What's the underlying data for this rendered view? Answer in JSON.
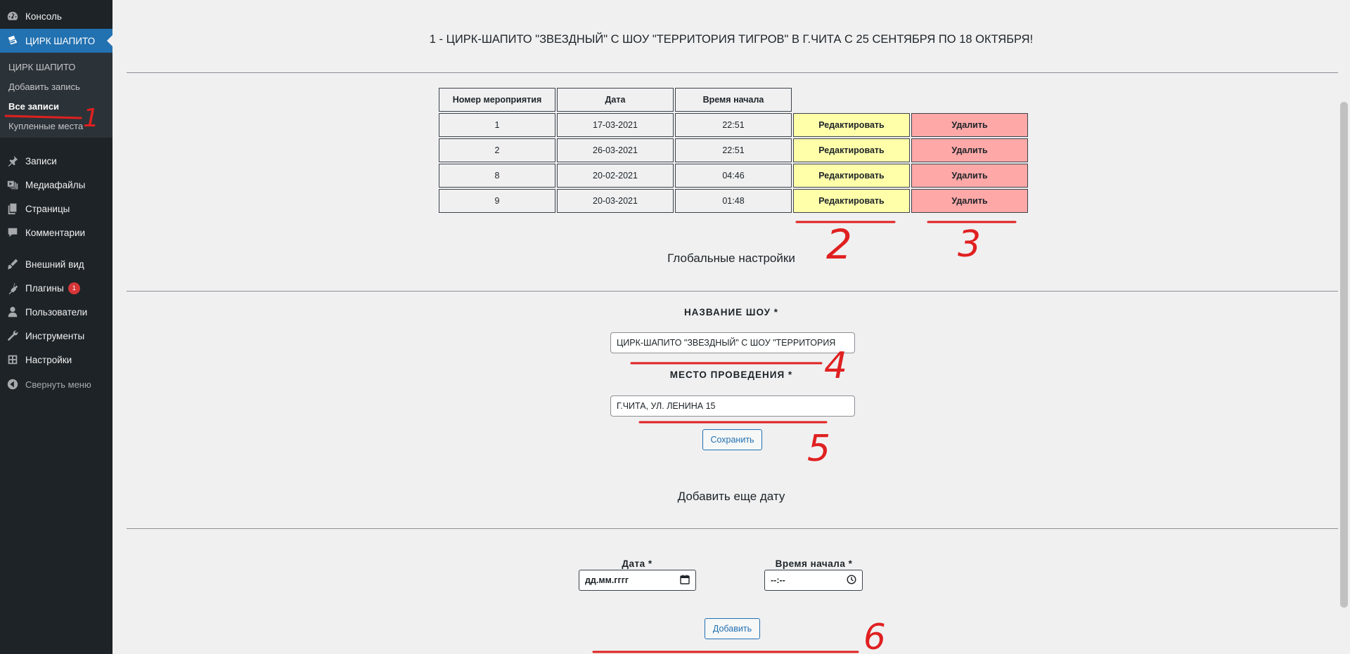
{
  "sidebar": {
    "items": [
      {
        "label": "Консоль",
        "icon": "dashboard-icon"
      },
      {
        "label": "ЦИРК ШАПИТО",
        "icon": "tickets-icon",
        "current": true
      },
      {
        "label": "Записи",
        "icon": "pin-icon"
      },
      {
        "label": "Медиафайлы",
        "icon": "media-icon"
      },
      {
        "label": "Страницы",
        "icon": "pages-icon"
      },
      {
        "label": "Комментарии",
        "icon": "comment-icon"
      },
      {
        "label": "Внешний вид",
        "icon": "brush-icon"
      },
      {
        "label": "Плагины",
        "icon": "plugin-icon",
        "badge": "1"
      },
      {
        "label": "Пользователи",
        "icon": "user-icon"
      },
      {
        "label": "Инструменты",
        "icon": "wrench-icon"
      },
      {
        "label": "Настройки",
        "icon": "settings-icon"
      }
    ],
    "submenu": [
      {
        "label": "ЦИРК ШАПИТО"
      },
      {
        "label": "Добавить запись"
      },
      {
        "label": "Все записи",
        "active": true
      },
      {
        "label": "Купленные места"
      }
    ],
    "collapse_label": "Свернуть меню"
  },
  "main": {
    "title": "1 - ЦИРК-ШАПИТО \"ЗВЕЗДНЫЙ\" С ШОУ \"ТЕРРИТОРИЯ ТИГРОВ\" В Г.ЧИТА С 25 СЕНТЯБРЯ ПО 18 ОКТЯБРЯ!",
    "table": {
      "headers": [
        "Номер мероприятия",
        "Дата",
        "Время начала"
      ],
      "rows": [
        {
          "id": "1",
          "date": "17-03-2021",
          "time": "22:51"
        },
        {
          "id": "2",
          "date": "26-03-2021",
          "time": "22:51"
        },
        {
          "id": "8",
          "date": "20-02-2021",
          "time": "04:46"
        },
        {
          "id": "9",
          "date": "20-03-2021",
          "time": "01:48"
        }
      ],
      "edit_label": "Редактировать",
      "delete_label": "Удалить"
    },
    "global_settings": {
      "heading": "Глобальные настройки",
      "show_name_label": "НАЗВАНИЕ ШОУ *",
      "show_name_value": "ЦИРК-ШАПИТО \"ЗВЕЗДНЫЙ\" С ШОУ \"ТЕРРИТОРИЯ",
      "venue_label": "МЕСТО ПРОВЕДЕНИЯ *",
      "venue_value": "Г.ЧИТА, УЛ. ЛЕНИНА 15",
      "save_label": "Сохранить"
    },
    "add_date": {
      "heading": "Добавить еще дату",
      "date_label": "Дата *",
      "date_placeholder": "дд.мм.гггг",
      "time_label": "Время начала *",
      "time_placeholder": "--:--",
      "add_label": "Добавить"
    },
    "annotations": [
      "1",
      "2",
      "3",
      "4",
      "5",
      "6"
    ]
  },
  "colors": {
    "sidebar_bg": "#1d2327",
    "accent": "#2271b1",
    "edit_bg": "#ffffaa",
    "delete_bg": "#ffa8a8",
    "annotation": "#e02020"
  }
}
